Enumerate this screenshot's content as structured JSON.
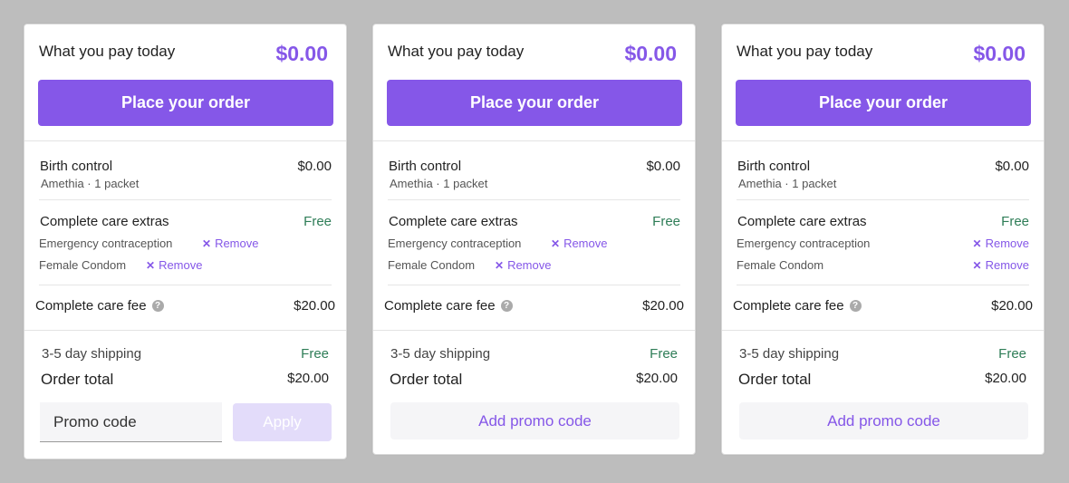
{
  "colors": {
    "accent": "#8557e8",
    "accent_disabled": "#e3dcfa",
    "free_green": "#2e7d57",
    "background": "#bdbdbd"
  },
  "cards": [
    {
      "pay_label": "What you pay today",
      "pay_amount": "$0.00",
      "place_order": "Place your order",
      "item": {
        "title": "Birth control",
        "subtitle": "Amethia · 1 packet",
        "price": "$0.00"
      },
      "extras": {
        "title": "Complete care extras",
        "free": "Free",
        "items": [
          {
            "name": "Emergency contraception",
            "remove": "Remove"
          },
          {
            "name": "Female Condom",
            "remove": "Remove"
          }
        ]
      },
      "fee": {
        "label": "Complete care fee",
        "help_icon": "question-icon",
        "price": "$20.00"
      },
      "shipping": {
        "label": "3-5 day shipping",
        "value": "Free"
      },
      "total": {
        "label": "Order total",
        "value": "$20.00"
      },
      "promo": {
        "placeholder": "Promo code",
        "apply": "Apply",
        "apply_disabled": true
      }
    },
    {
      "pay_label": "What you pay today",
      "pay_amount": "$0.00",
      "place_order": "Place your order",
      "item": {
        "title": "Birth control",
        "subtitle": "Amethia · 1 packet",
        "price": "$0.00"
      },
      "extras": {
        "title": "Complete care extras",
        "free": "Free",
        "items": [
          {
            "name": "Emergency contraception",
            "remove": "Remove"
          },
          {
            "name": "Female Condom",
            "remove": "Remove"
          }
        ]
      },
      "fee": {
        "label": "Complete care fee",
        "help_icon": "question-icon",
        "price": "$20.00"
      },
      "shipping": {
        "label": "3-5 day shipping",
        "value": "Free"
      },
      "total": {
        "label": "Order total",
        "value": "$20.00"
      },
      "promo": {
        "add_label": "Add promo code"
      }
    },
    {
      "pay_label": "What you pay today",
      "pay_amount": "$0.00",
      "place_order": "Place your order",
      "item": {
        "title": "Birth control",
        "subtitle": "Amethia · 1 packet",
        "price": "$0.00"
      },
      "extras": {
        "title": "Complete care extras",
        "free": "Free",
        "items": [
          {
            "name": "Emergency contraception",
            "remove": "Remove"
          },
          {
            "name": "Female Condom",
            "remove": "Remove"
          }
        ]
      },
      "fee": {
        "label": "Complete care fee",
        "help_icon": "question-icon",
        "price": "$20.00"
      },
      "shipping": {
        "label": "3-5 day shipping",
        "value": "Free"
      },
      "total": {
        "label": "Order total",
        "value": "$20.00"
      },
      "promo": {
        "add_label": "Add promo code"
      }
    }
  ]
}
